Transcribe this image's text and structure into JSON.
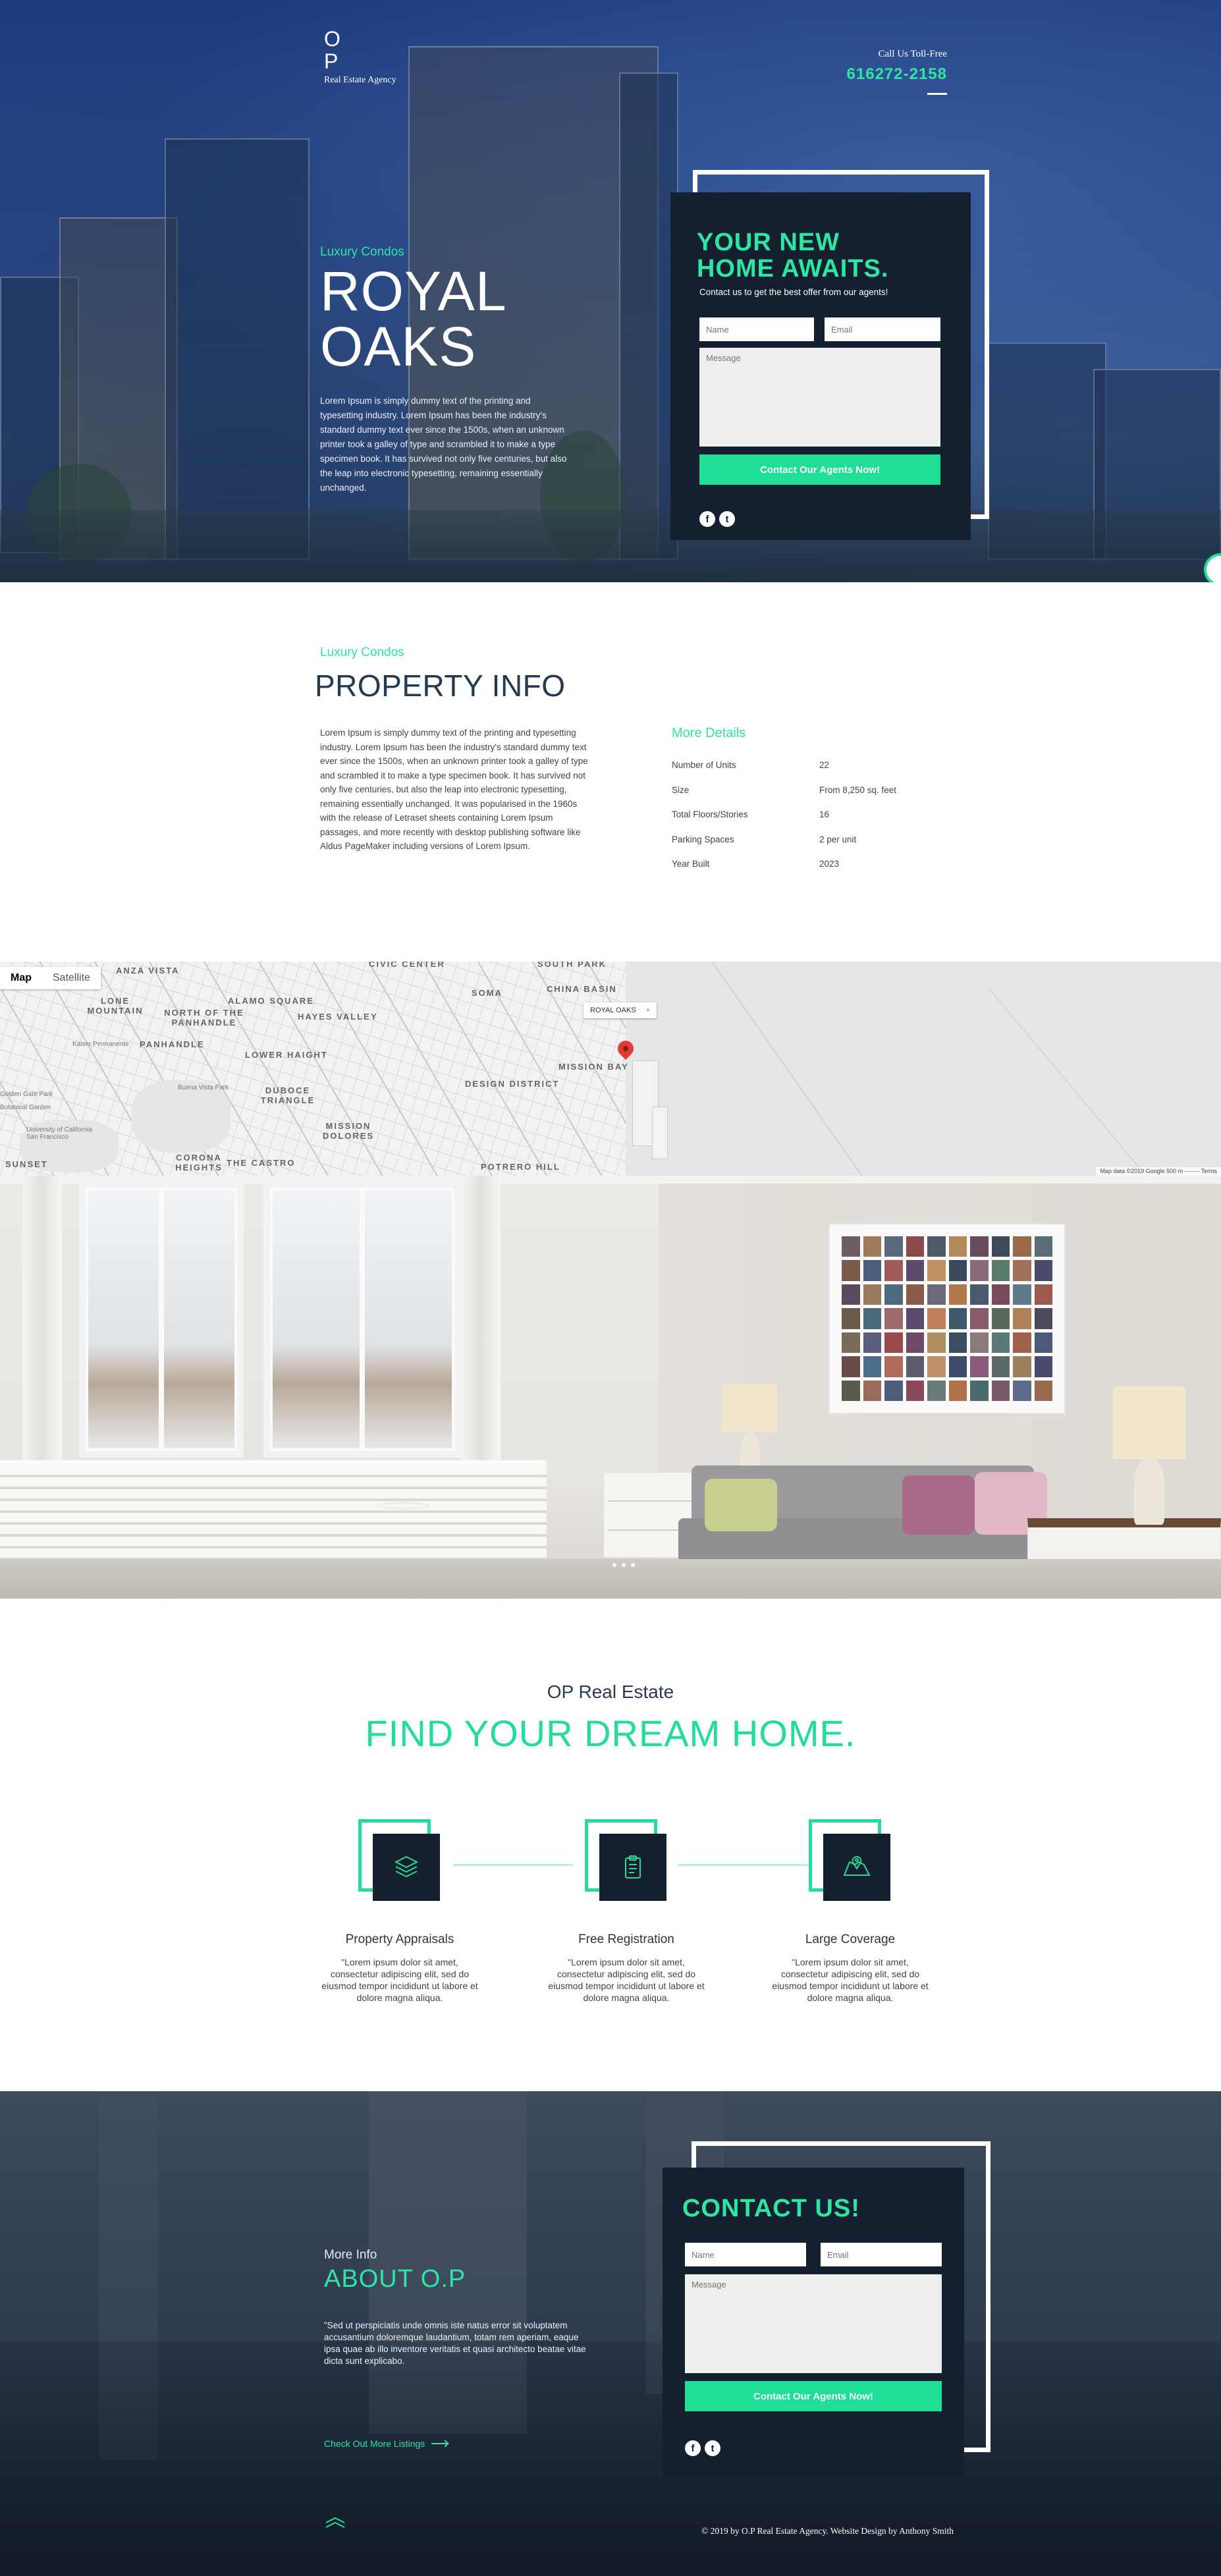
{
  "hero": {
    "logo_mark": "O\nP",
    "logo_sub": "Real Estate Agency",
    "call_label": "Call Us Toll-Free",
    "phone": "616272-2158",
    "kicker": "Luxury Condos",
    "title_line1": "ROYAL",
    "title_line2": "OAKS",
    "description": "Lorem Ipsum is simply dummy text of the printing and typesetting industry. Lorem Ipsum has been the industry's standard dummy text ever since the 1500s, when an unknown printer took a galley of type and scrambled it to make a type specimen book. It has survived not only five centuries, but also the leap into electronic typesetting, remaining essentially unchanged."
  },
  "hero_form": {
    "title_line1": "YOUR NEW",
    "title_line2": "HOME AWAITS.",
    "note": "Contact us to get the best offer from our agents!",
    "name_placeholder": "Name",
    "email_placeholder": "Email",
    "message_placeholder": "Message",
    "submit": "Contact Our Agents Now!",
    "facebook": "f",
    "twitter": "t"
  },
  "property": {
    "kicker": "Luxury Condos",
    "title": "PROPERTY INFO",
    "description": "Lorem Ipsum is simply dummy text of the printing and typesetting industry. Lorem Ipsum has been the industry's standard dummy text ever since the 1500s, when an unknown printer took a galley of type and scrambled it to make a type specimen book. It has survived not only five centuries, but also the leap into electronic typesetting, remaining essentially unchanged. It was popularised in the 1960s with the release of Letraset sheets containing Lorem Ipsum passages, and more recently with desktop publishing software like Aldus PageMaker including versions of Lorem Ipsum.",
    "details_title": "More Details",
    "specs": [
      {
        "label": "Number of Units",
        "value": "22"
      },
      {
        "label": "Size",
        "value": "From 8,250 sq. feet"
      },
      {
        "label": "Total Floors/Stories",
        "value": "16"
      },
      {
        "label": "Parking Spaces",
        "value": "2 per unit"
      },
      {
        "label": "Year Built",
        "value": "2023"
      }
    ]
  },
  "map": {
    "tab_map": "Map",
    "tab_satellite": "Satellite",
    "marker_label": "ROYAL OAKS",
    "marker_close": "×",
    "credit": "Map data ©2019 Google   500 m ⎯⎯⎯⎯⎯   Terms",
    "labels": [
      "ANZA VISTA",
      "CIVIC CENTER",
      "SOUTH PARK",
      "CHINA BASIN",
      "SOMA",
      "LONE MOUNTAIN",
      "NORTH OF THE PANHANDLE",
      "ALAMO SQUARE",
      "HAYES VALLEY",
      "PANHANDLE",
      "LOWER HAIGHT",
      "MISSION BAY",
      "DESIGN DISTRICT",
      "DUBOCE TRIANGLE",
      "MISSION DOLORES",
      "CORONA HEIGHTS",
      "THE CASTRO",
      "POTRERO HILL",
      "SUNSET"
    ],
    "small_labels": [
      "Kaiser Permanente",
      "Buena Vista Park",
      "University of California San Francisco",
      "Golden Gate Park",
      "Botanical Garden"
    ]
  },
  "dream": {
    "brand": "OP Real Estate",
    "title": "FIND YOUR DREAM HOME.",
    "features": [
      {
        "title": "Property Appraisals",
        "text": "\"Lorem ipsum dolor sit amet, consectetur adipiscing elit, sed do eiusmod tempor incididunt ut labore et dolore magna aliqua."
      },
      {
        "title": "Free Registration",
        "text": "\"Lorem ipsum dolor sit amet, consectetur adipiscing elit, sed do eiusmod tempor incididunt ut labore et dolore magna aliqua."
      },
      {
        "title": "Large Coverage",
        "text": "\"Lorem ipsum dolor sit amet, consectetur adipiscing elit, sed do eiusmod tempor incididunt ut labore et dolore magna aliqua."
      }
    ]
  },
  "about": {
    "kicker": "More Info",
    "title": "ABOUT O.P",
    "text": "\"Sed ut perspiciatis unde omnis iste natus error sit voluptatem accusantium doloremque laudantium, totam rem aperiam, eaque ipsa quae ab illo inventore veritatis et quasi architecto beatae vitae dicta sunt explicabo.",
    "more_link": "Check Out More Listings"
  },
  "contact_form": {
    "title": "CONTACT US!",
    "name_placeholder": "Name",
    "email_placeholder": "Email",
    "message_placeholder": "Message",
    "submit": "Contact Our Agents Now!",
    "facebook": "f",
    "twitter": "t"
  },
  "footer": {
    "copyright": "© 2019 by O.P Real Estate Agency. Website Design by Anthony Smith"
  },
  "colors": {
    "accent": "#22dc98",
    "dark_panel": "#14202f",
    "heading": "#233a55"
  }
}
